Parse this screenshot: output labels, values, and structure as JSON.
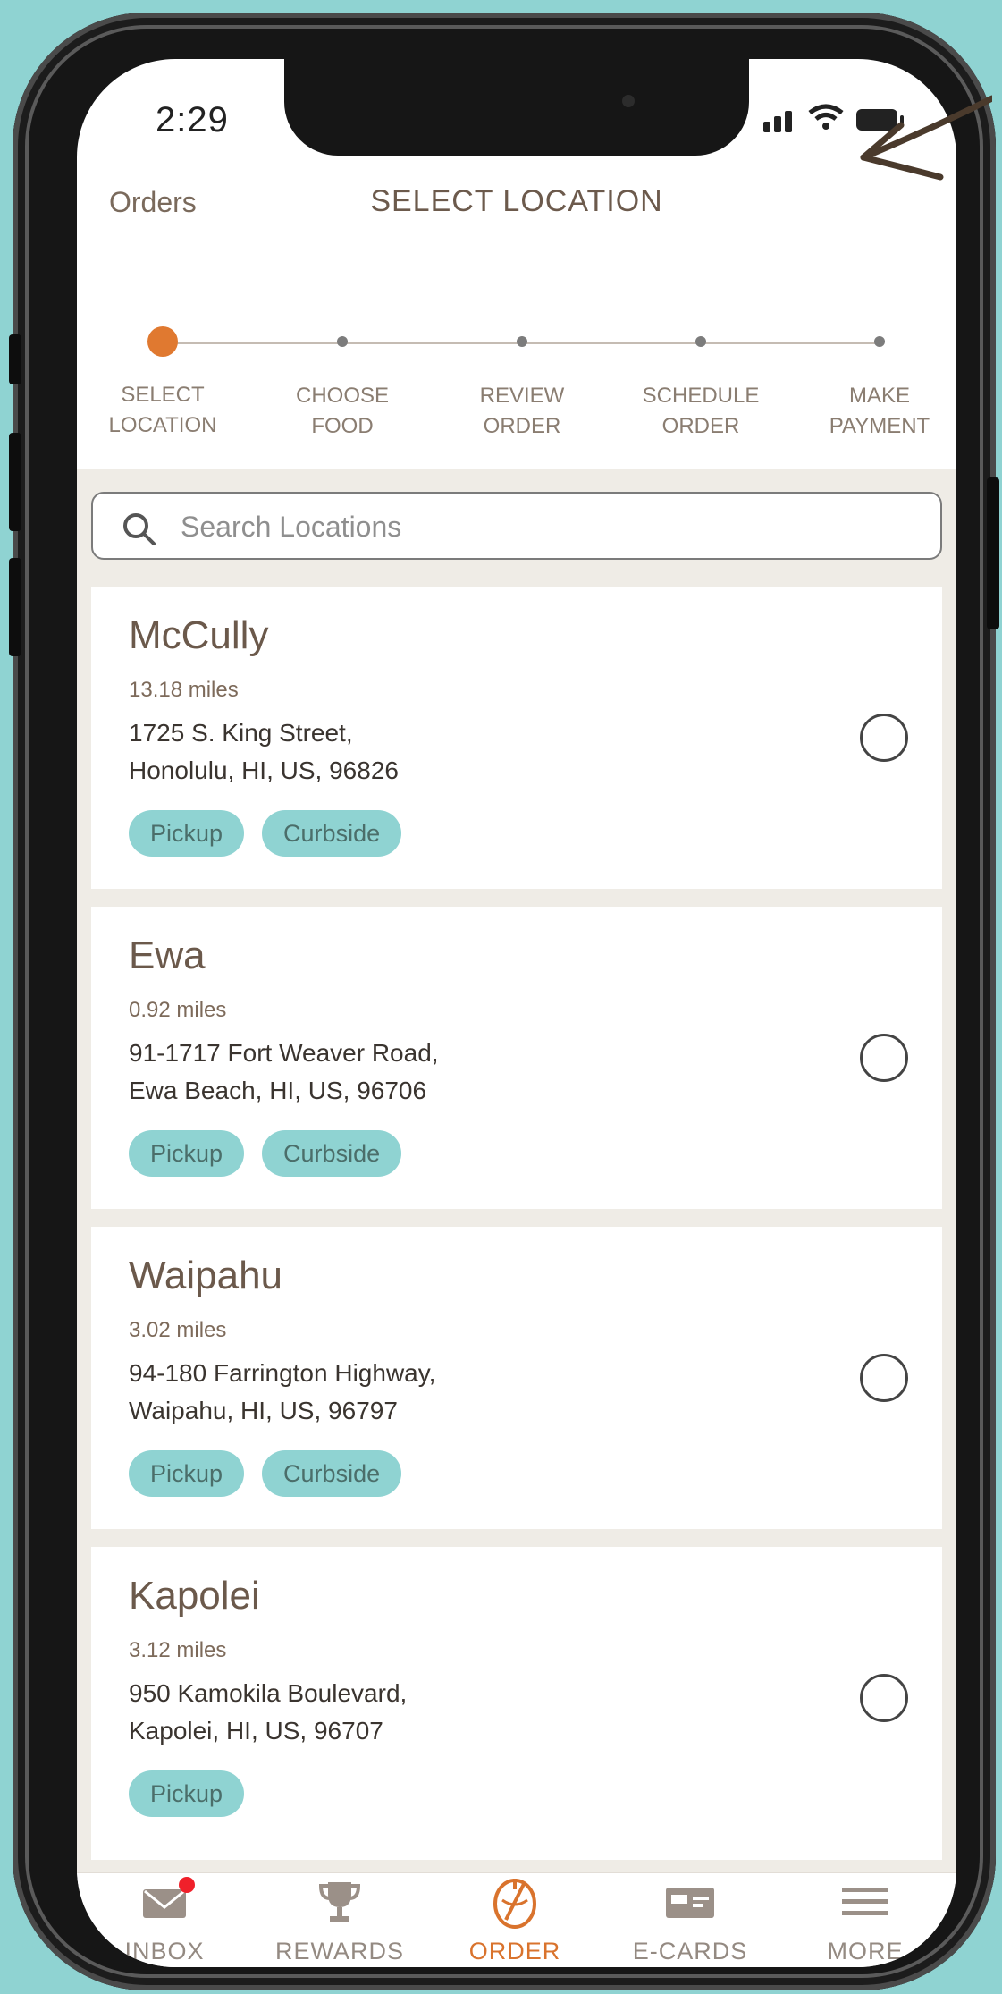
{
  "status_bar": {
    "time": "2:29"
  },
  "nav": {
    "back_label": "Orders",
    "title": "SELECT LOCATION"
  },
  "steps": [
    {
      "label": "SELECT\nLOCATION",
      "active": true
    },
    {
      "label": "CHOOSE\nFOOD",
      "active": false
    },
    {
      "label": "REVIEW\nORDER",
      "active": false
    },
    {
      "label": "SCHEDULE\nORDER",
      "active": false
    },
    {
      "label": "MAKE\nPAYMENT",
      "active": false
    }
  ],
  "search": {
    "placeholder": "Search Locations",
    "value": ""
  },
  "locations": [
    {
      "name": "McCully",
      "distance": "13.18 miles",
      "address_line1": "1725 S. King Street,",
      "address_line2": "Honolulu, HI, US, 96826",
      "tags": [
        "Pickup",
        "Curbside"
      ],
      "selected": false
    },
    {
      "name": "Ewa",
      "distance": "0.92 miles",
      "address_line1": "91-1717 Fort Weaver Road,",
      "address_line2": "Ewa Beach, HI, US, 96706",
      "tags": [
        "Pickup",
        "Curbside"
      ],
      "selected": false
    },
    {
      "name": "Waipahu",
      "distance": "3.02 miles",
      "address_line1": "94-180 Farrington Highway,",
      "address_line2": "Waipahu, HI, US, 96797",
      "tags": [
        "Pickup",
        "Curbside"
      ],
      "selected": false
    },
    {
      "name": "Kapolei",
      "distance": "3.12 miles",
      "address_line1": "950 Kamokila Boulevard,",
      "address_line2": "Kapolei, HI, US, 96707",
      "tags": [
        "Pickup"
      ],
      "selected": false
    }
  ],
  "tabbar": {
    "items": [
      {
        "label": "INBOX",
        "icon": "envelope-icon",
        "has_badge": true
      },
      {
        "label": "REWARDS",
        "icon": "trophy-icon"
      },
      {
        "label": "ORDER",
        "icon": "order-icon",
        "active": true
      },
      {
        "label": "E-CARDS",
        "icon": "gift-card-icon"
      },
      {
        "label": "MORE",
        "icon": "menu-icon"
      }
    ]
  },
  "colors": {
    "accent": "#e07930",
    "tag_bg": "#8fd3d2",
    "background": "#8fd3d2",
    "badge": "#f0202a"
  }
}
